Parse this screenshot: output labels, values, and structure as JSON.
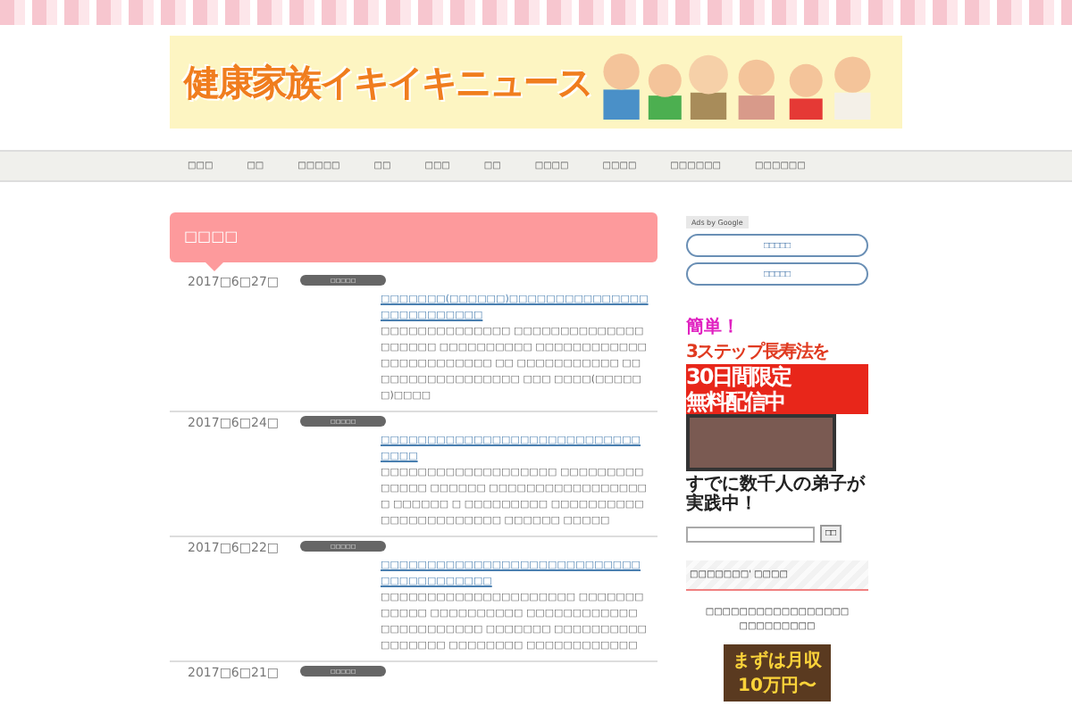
{
  "header": {
    "title": "健康家族イキイキニュース"
  },
  "nav": [
    {
      "label": "□□□"
    },
    {
      "label": "□□"
    },
    {
      "label": "□□□□□"
    },
    {
      "label": "□□"
    },
    {
      "label": "□□□"
    },
    {
      "label": "□□"
    },
    {
      "label": "□□□□"
    },
    {
      "label": "□□□□"
    },
    {
      "label": "□□□□□□"
    },
    {
      "label": "□□□□□□"
    }
  ],
  "section_title": "□□□□",
  "posts": [
    {
      "date": "2017□6□27□",
      "tag": "□□□□□",
      "title": "□□□□□□□(□□□□□□)□□□□□□□□□□□□□□□□□□□□□□□□□□",
      "excerpt": "□□□□□□□□□□□□□□ □□□□□□□□□□□□□□□□□□□□ □□□□□□□□□□ □□□□□□□□□□□□□□□□□□□□□□□□ □□ □□□□□□□□□□□ □□□□□□□□□□□□□□□□□ □□□ □□□□(□□□□□□)□□□□"
    },
    {
      "date": "2017□6□24□",
      "tag": "□□□□□",
      "title": "□□□□□□□□□□□□□□□□□□□□□□□□□□□□□□□□",
      "excerpt": "□□□□□□□□□□□□□□□□□□□ □□□□□□□□□□□□□□ □□□□□□ □□□□□□□□□□□□□□□□□□ □□□□□□ □ □□□□□□□□□ □□□□□□□□□□□□□□□□□□□□□□□ □□□□□□ □□□□□"
    },
    {
      "date": "2017□6□22□",
      "tag": "□□□□□",
      "title": "□□□□□□□□□□□□□□□□□□□□□□□□□□□□□□□□□□□□□□□□",
      "excerpt": "□□□□□□□□□□□□□□□□□□□□□ □□□□□□□□□□□□ □□□□□□□□□□ □□□□□□□□□□□□ □□□□□□□□□□□ □□□□□□□ □□□□□□□□□□□□□□□□□ □□□□□□□□ □□□□□□□□□□□□"
    },
    {
      "date": "2017□6□21□",
      "tag": "□□□□□"
    }
  ],
  "sidebar": {
    "ads_label": "Ads by Google",
    "ad_links": [
      "□□□□□",
      "□□□□□"
    ],
    "banner": {
      "line_1": "簡単！",
      "line_2": "3ステップ長寿法を",
      "line_3": "30日間限定",
      "line_4": "無料配信中",
      "caption": "すでに数千人の弟子が実践中！"
    },
    "search": {
      "button": "□□"
    },
    "widget": {
      "title": "□□□□□□□' □□□□",
      "text": "□□□□□□□□□□□□□□□□□ □□□□□□□□□",
      "banner_line_1": "まずは月収",
      "banner_line_2": "10万円〜"
    }
  }
}
